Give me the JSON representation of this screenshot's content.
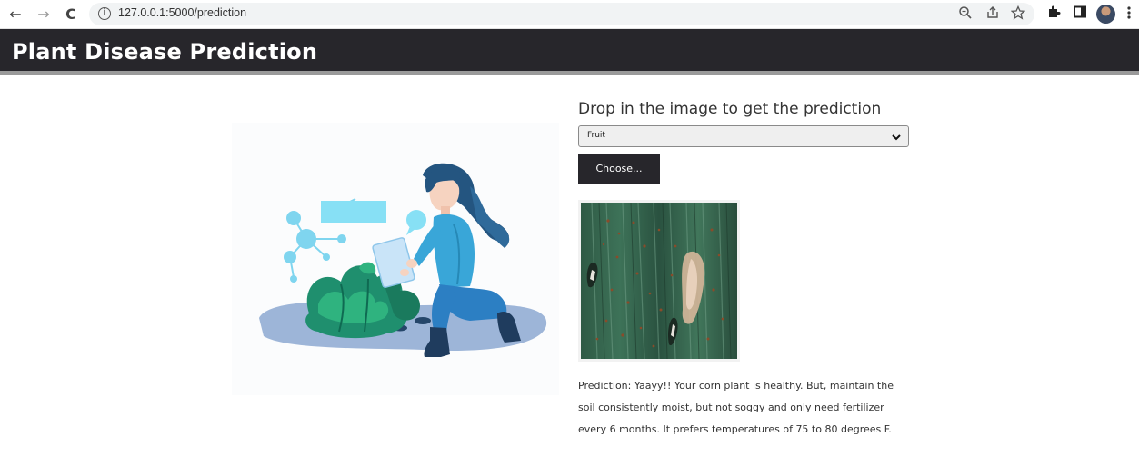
{
  "browser": {
    "url": "127.0.0.1:5000/prediction",
    "back_glyph": "←",
    "forward_glyph": "→",
    "reload_glyph": "C",
    "info_glyph": "i",
    "icons": [
      "back-icon",
      "forward-icon",
      "reload-icon",
      "info-icon",
      "zoom-icon",
      "share-icon",
      "star-icon",
      "extensions-icon",
      "sidepanel-icon",
      "profile-avatar",
      "menu-icon"
    ]
  },
  "header": {
    "title": "Plant Disease Prediction",
    "background": "#27262b"
  },
  "main": {
    "heading": "Drop in the image to get the prediction",
    "category_select": {
      "selected": "Fruit"
    },
    "choose_button": "Choose...",
    "prediction_text": "Prediction: Yaayy!! Your corn plant is healthy. But, maintain the soil consistently moist, but not soggy and only need fertilizer every 6 months. It prefers temperatures of 75 to 80 degrees F."
  }
}
